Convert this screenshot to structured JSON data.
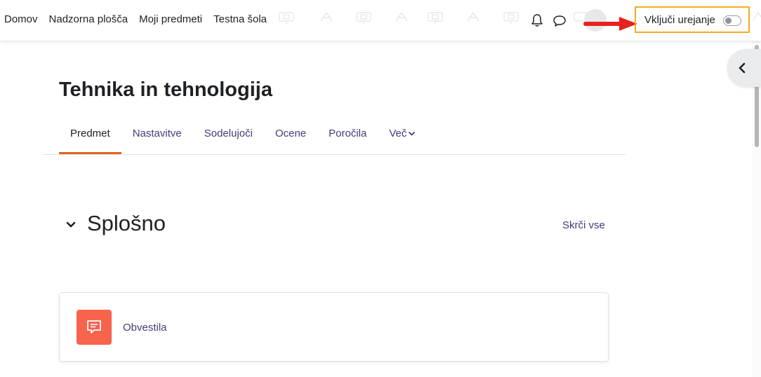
{
  "navbar": {
    "links": [
      "Domov",
      "Nadzorna plošča",
      "Moji predmeti",
      "Testna šola"
    ],
    "edit_mode_label": "Vključi urejanje",
    "edit_mode_on": false,
    "icons": [
      "bell-icon",
      "message-icon",
      "user-avatar"
    ]
  },
  "course": {
    "title": "Tehnika in tehnologija",
    "tabs": [
      {
        "label": "Predmet",
        "active": true
      },
      {
        "label": "Nastavitve",
        "active": false
      },
      {
        "label": "Sodelujoči",
        "active": false
      },
      {
        "label": "Ocene",
        "active": false
      },
      {
        "label": "Poročila",
        "active": false
      },
      {
        "label": "Več",
        "active": false
      }
    ]
  },
  "section": {
    "title": "Splošno",
    "collapse_all": "Skrči vse"
  },
  "activity": {
    "name": "Obvestila",
    "icon": "forum-icon",
    "icon_color": "#f7634d"
  },
  "colors": {
    "accent": "#e0621f",
    "link": "#4a3978",
    "highlight": "#f0ad1f",
    "annotation_arrow": "#e8221e"
  }
}
